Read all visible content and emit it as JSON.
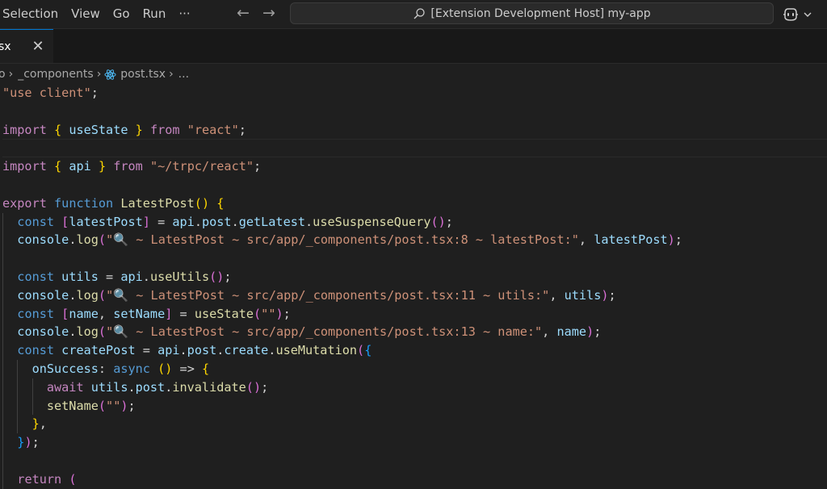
{
  "menu": {
    "items": [
      "Selection",
      "View",
      "Go",
      "Run"
    ],
    "more": "···"
  },
  "nav": {
    "back": "←",
    "forward": "→"
  },
  "search": {
    "text": "[Extension Development Host] my-app"
  },
  "tab": {
    "label": "sx",
    "close": "✕"
  },
  "breadcrumb": {
    "items": [
      "o",
      "_components",
      "post.tsx",
      "..."
    ]
  },
  "code": {
    "lines": [
      "\"use client\";",
      "",
      "import { useState } from \"react\";",
      "",
      "import { api } from \"~/trpc/react\";",
      "",
      "export function LatestPost() {",
      "  const [latestPost] = api.post.getLatest.useSuspenseQuery();",
      "  console.log(\"🔍 ~ LatestPost ~ src/app/_components/post.tsx:8 ~ latestPost:\", latestPost);",
      "",
      "  const utils = api.useUtils();",
      "  console.log(\"🔍 ~ LatestPost ~ src/app/_components/post.tsx:11 ~ utils:\", utils);",
      "  const [name, setName] = useState(\"\");",
      "  console.log(\"🔍 ~ LatestPost ~ src/app/_components/post.tsx:13 ~ name:\", name);",
      "  const createPost = api.post.create.useMutation({",
      "    onSuccess: async () => {",
      "      await utils.post.invalidate();",
      "      setName(\"\");",
      "    },",
      "  });",
      "",
      "  return ("
    ]
  },
  "colors": {
    "keyword": "#569cd6",
    "control": "#c586c0",
    "string": "#ce9178",
    "function": "#dcdcaa",
    "variable": "#9cdcfe",
    "accent": "#0078d4"
  }
}
